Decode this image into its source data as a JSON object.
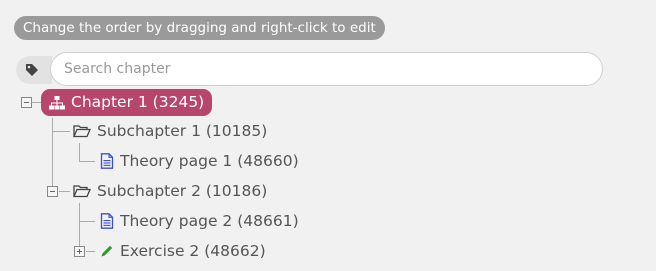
{
  "hint": "Change the order by dragging and right-click to edit",
  "search": {
    "placeholder": "Search chapter",
    "value": ""
  },
  "tree": {
    "root": {
      "label": "Chapter 1 (3245)",
      "color": "#b8456b"
    },
    "subchapter1": {
      "label": "Subchapter 1 (10185)"
    },
    "theory1": {
      "label": "Theory page 1 (48660)"
    },
    "subchapter2": {
      "label": "Subchapter 2 (10186)"
    },
    "theory2": {
      "label": "Theory page 2 (48661)"
    },
    "exercise2": {
      "label": "Exercise 2 (48662)"
    }
  },
  "icons": {
    "tag": "tag-icon",
    "sitemap": "sitemap-icon",
    "folder": "folder-open-icon",
    "document": "document-icon",
    "pencil": "pencil-icon"
  },
  "colors": {
    "document_icon": "#3b4fd6",
    "pencil_icon": "#2e9d2e"
  }
}
